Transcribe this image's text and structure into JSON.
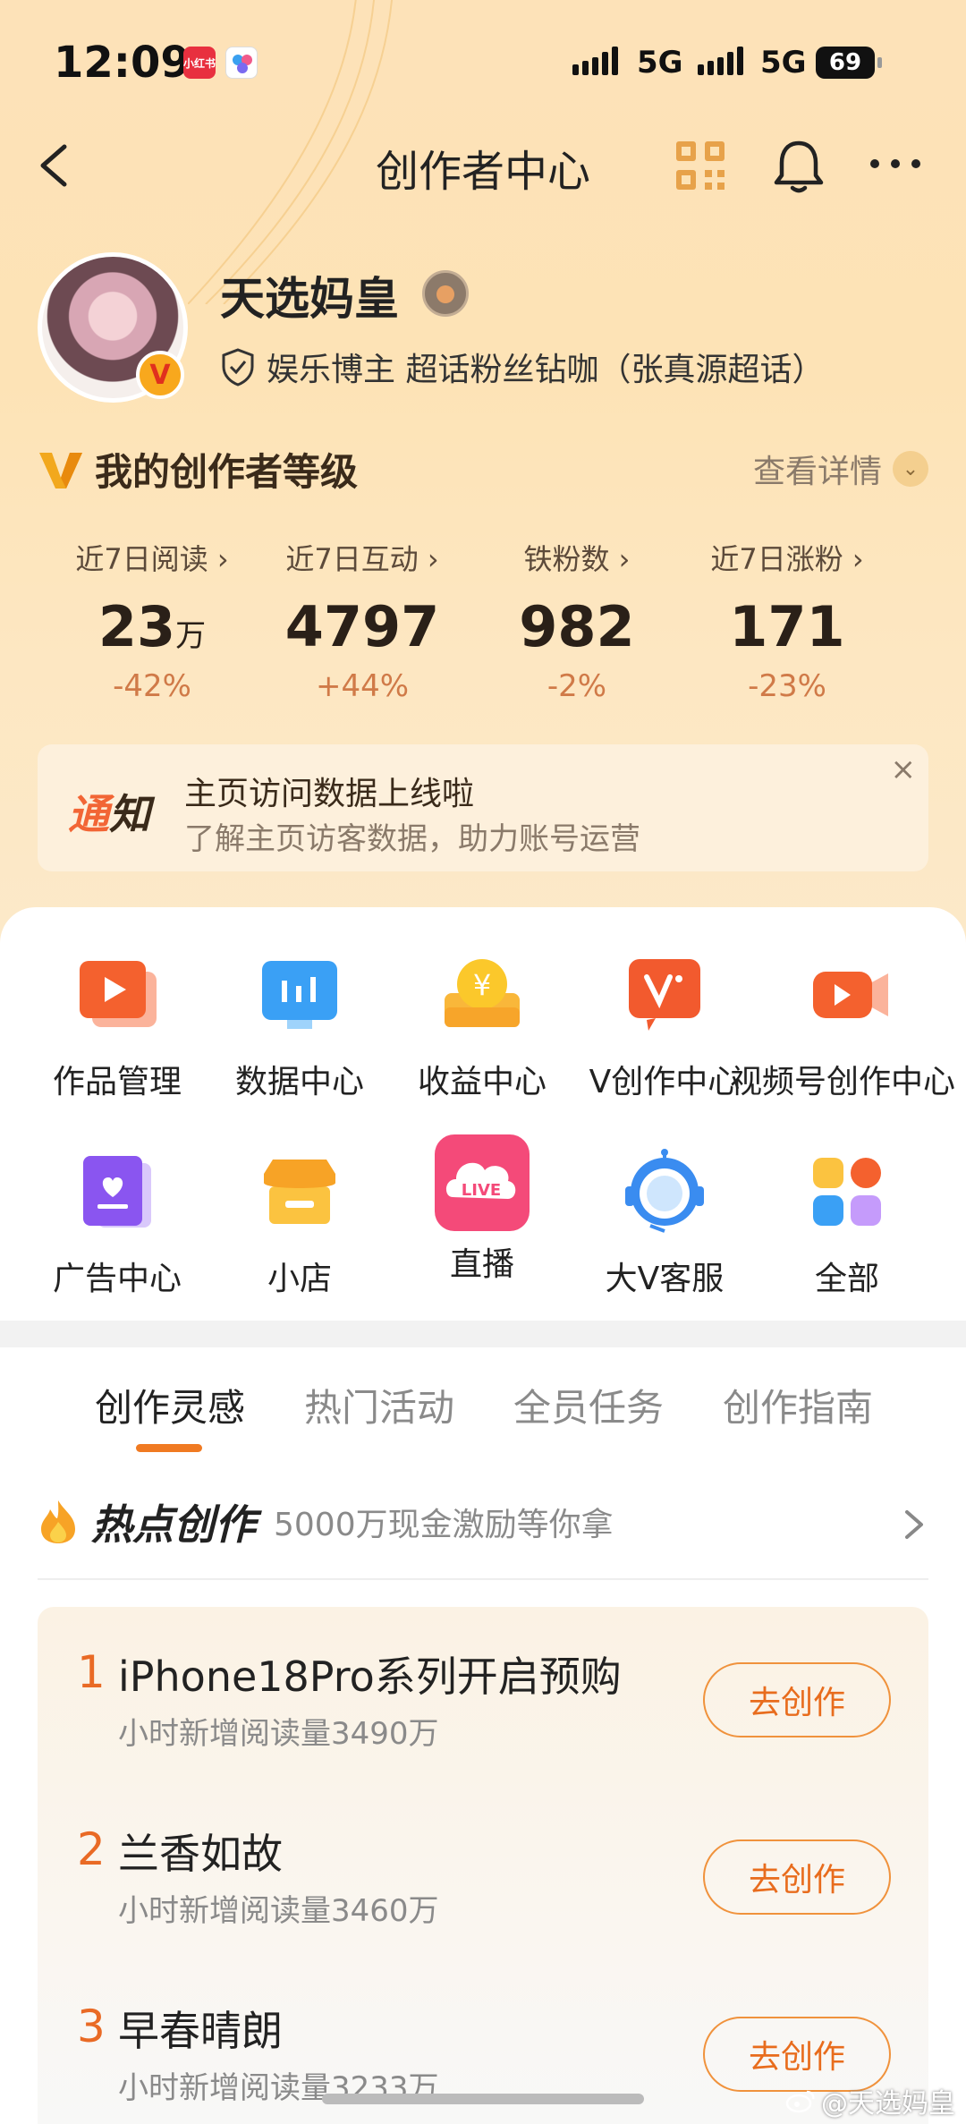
{
  "status_bar": {
    "time": "12:09",
    "app_icon_1": "小红书",
    "network_1": "5G",
    "network_2": "5G",
    "battery": "69"
  },
  "nav": {
    "title": "创作者中心"
  },
  "profile": {
    "name": "天选妈皇",
    "verify_text": "娱乐博主 超话粉丝钻咖（张真源超话）"
  },
  "level": {
    "title": "我的创作者等级",
    "detail_label": "查看详情"
  },
  "stats": [
    {
      "label": "近7日阅读 ›",
      "value": "23",
      "unit": "万",
      "change": "-42%"
    },
    {
      "label": "近7日互动 ›",
      "value": "4797",
      "unit": "",
      "change": "+44%"
    },
    {
      "label": "铁粉数 ›",
      "value": "982",
      "unit": "",
      "change": "-2%"
    },
    {
      "label": "近7日涨粉 ›",
      "value": "171",
      "unit": "",
      "change": "-23%"
    }
  ],
  "notice": {
    "tag_a": "通",
    "tag_b": "知",
    "title": "主页访问数据上线啦",
    "subtitle": "了解主页访客数据，助力账号运营",
    "close": "×"
  },
  "tools": [
    {
      "label": "作品管理",
      "icon": "works-icon"
    },
    {
      "label": "数据中心",
      "icon": "data-icon"
    },
    {
      "label": "收益中心",
      "icon": "income-icon"
    },
    {
      "label": "V创作中心",
      "icon": "v-create-icon"
    },
    {
      "label": "视频号创作中心",
      "icon": "video-icon"
    },
    {
      "label": "广告中心",
      "icon": "ad-icon"
    },
    {
      "label": "小店",
      "icon": "shop-icon"
    },
    {
      "label": "直播",
      "icon": "live-icon"
    },
    {
      "label": "大V客服",
      "icon": "service-icon"
    },
    {
      "label": "全部",
      "icon": "all-icon"
    }
  ],
  "tabs": [
    "创作灵感",
    "热门活动",
    "全员任务",
    "创作指南"
  ],
  "hot": {
    "title": "热点创作",
    "subtitle": "5000万现金激励等你拿",
    "items": [
      {
        "rank": "1",
        "title": "iPhone18Pro系列开启预购",
        "sub": "小时新增阅读量3490万",
        "button": "去创作"
      },
      {
        "rank": "2",
        "title": "兰香如故",
        "sub": "小时新增阅读量3460万",
        "button": "去创作"
      },
      {
        "rank": "3",
        "title": "早春晴朗",
        "sub": "小时新增阅读量3233万",
        "button": "去创作"
      }
    ]
  },
  "watermark": "@天选妈皇",
  "colors": {
    "accent": "#f07a22",
    "gradient_top": "#fde2b8"
  }
}
